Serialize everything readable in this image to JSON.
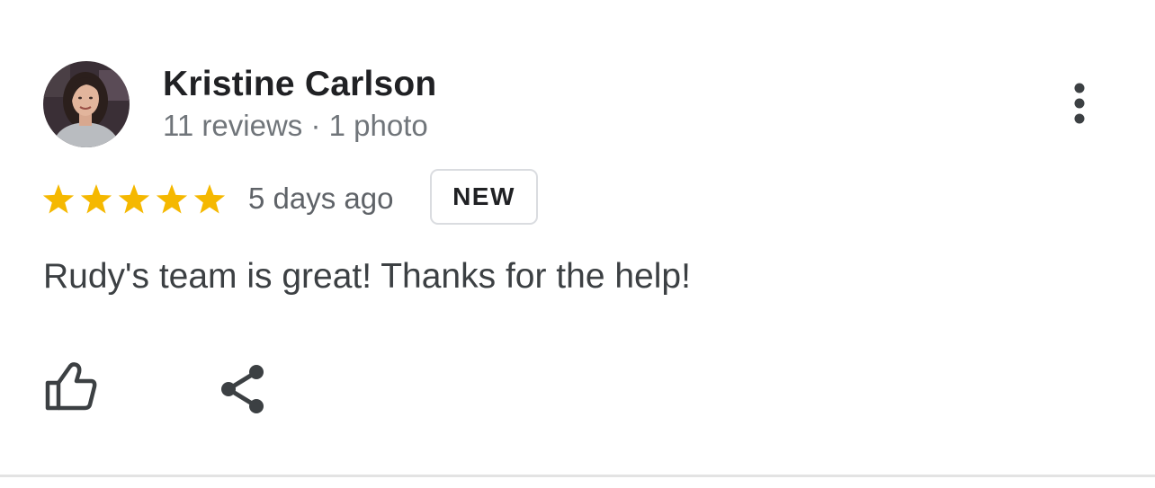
{
  "review": {
    "author_name": "Kristine Carlson",
    "author_meta": "11 reviews · 1 photo",
    "rating": 5,
    "rating_max": 5,
    "date": "5 days ago",
    "badge": "NEW",
    "text": "Rudy's team is great! Thanks for the help!"
  },
  "icons": {
    "more": "more-vert-icon",
    "like": "thumb-up-icon",
    "share": "share-icon",
    "star": "star-icon"
  },
  "colors": {
    "star": "#f5b800",
    "icon": "#3c4043",
    "meta_text": "#70757a",
    "badge_border": "#dadce0"
  }
}
